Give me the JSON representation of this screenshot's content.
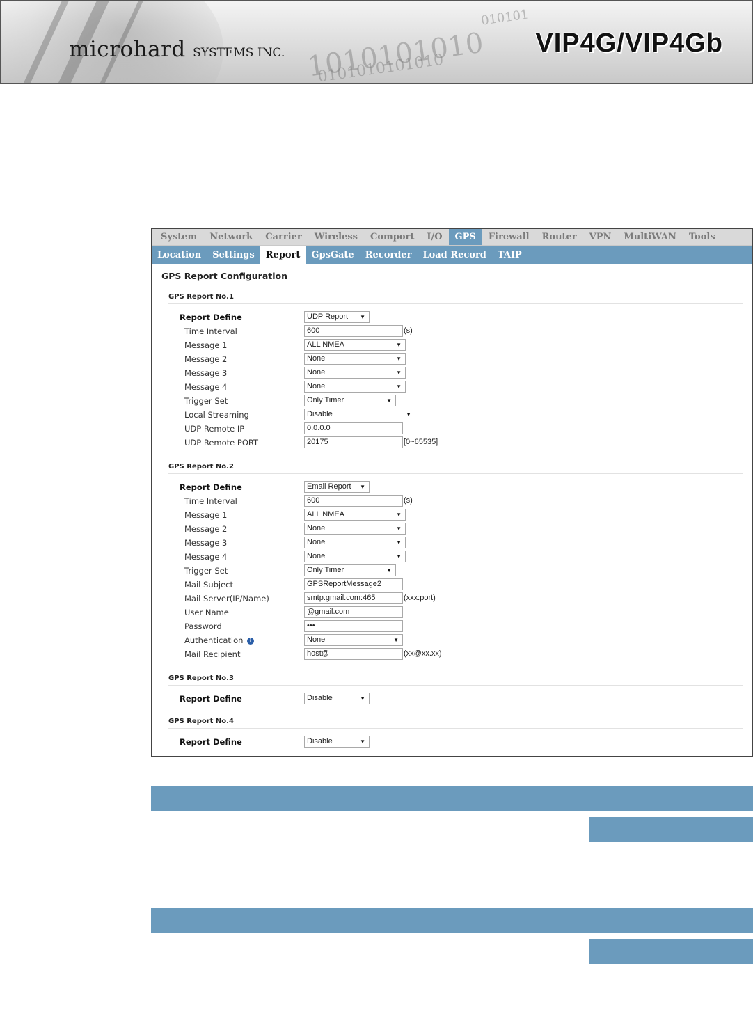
{
  "header": {
    "brand": "microhard",
    "brand_sub": "SYSTEMS INC.",
    "product": "VIP4G/VIP4Gb",
    "binary_line1": "1010101010",
    "binary_line2": "0101010101010",
    "binary_line3": "010101"
  },
  "top_nav": [
    "System",
    "Network",
    "Carrier",
    "Wireless",
    "Comport",
    "I/O",
    "GPS",
    "Firewall",
    "Router",
    "VPN",
    "MultiWAN",
    "Tools"
  ],
  "top_nav_active": "GPS",
  "sub_nav": [
    "Location",
    "Settings",
    "Report",
    "GpsGate",
    "Recorder",
    "Load Record",
    "TAIP"
  ],
  "sub_nav_active": "Report",
  "page_title": "GPS Report Configuration",
  "report1": {
    "heading": "GPS Report No.1",
    "report_define_label": "Report Define",
    "report_define_value": "UDP Report",
    "time_interval_label": "Time Interval",
    "time_interval_value": "600",
    "time_interval_suffix": "(s)",
    "message1_label": "Message 1",
    "message1_value": "ALL NMEA",
    "message2_label": "Message 2",
    "message2_value": "None",
    "message3_label": "Message 3",
    "message3_value": "None",
    "message4_label": "Message 4",
    "message4_value": "None",
    "trigger_label": "Trigger Set",
    "trigger_value": "Only Timer",
    "streaming_label": "Local Streaming",
    "streaming_value": "Disable",
    "udp_ip_label": "UDP Remote IP",
    "udp_ip_value": "0.0.0.0",
    "udp_port_label": "UDP Remote PORT",
    "udp_port_value": "20175",
    "udp_port_suffix": "[0~65535]"
  },
  "report2": {
    "heading": "GPS Report No.2",
    "report_define_label": "Report Define",
    "report_define_value": "Email Report",
    "time_interval_label": "Time Interval",
    "time_interval_value": "600",
    "time_interval_suffix": "(s)",
    "message1_label": "Message 1",
    "message1_value": "ALL NMEA",
    "message2_label": "Message 2",
    "message2_value": "None",
    "message3_label": "Message 3",
    "message3_value": "None",
    "message4_label": "Message 4",
    "message4_value": "None",
    "trigger_label": "Trigger Set",
    "trigger_value": "Only Timer",
    "mail_subject_label": "Mail Subject",
    "mail_subject_value": "GPSReportMessage2",
    "mail_server_label": "Mail Server(IP/Name)",
    "mail_server_value": "smtp.gmail.com:465",
    "mail_server_suffix": "(xxx:port)",
    "user_name_label": "User Name",
    "user_name_value": "@gmail.com",
    "password_label": "Password",
    "password_value": "•••",
    "auth_label": "Authentication",
    "auth_value": "None",
    "recipient_label": "Mail Recipient",
    "recipient_value": "host@",
    "recipient_suffix": "(xx@xx.xx)"
  },
  "report3": {
    "heading": "GPS Report No.3",
    "report_define_label": "Report Define",
    "report_define_value": "Disable"
  },
  "report4": {
    "heading": "GPS Report No.4",
    "report_define_label": "Report Define",
    "report_define_value": "Disable"
  },
  "icons": {
    "select_arrow": "▼",
    "info": "i"
  },
  "colors": {
    "accent": "#6b9bbd",
    "top_nav_bg": "#d9d9d9",
    "info_icon": "#2a5ea8"
  }
}
